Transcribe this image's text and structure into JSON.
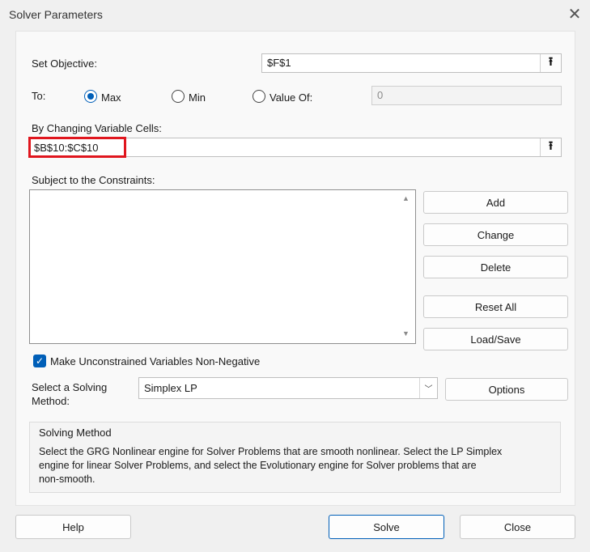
{
  "window": {
    "title": "Solver Parameters"
  },
  "objective": {
    "label": "Set Objective:",
    "value": "$F$1"
  },
  "to": {
    "label": "To:",
    "max_label": "Max",
    "min_label": "Min",
    "value_of_label": "Value Of:",
    "value_of_value": "0",
    "selected": "Max"
  },
  "changing": {
    "label": "By Changing Variable Cells:",
    "value": "$B$10:$C$10"
  },
  "constraints": {
    "label": "Subject to the Constraints:",
    "items": []
  },
  "buttons": {
    "add": "Add",
    "change": "Change",
    "delete": "Delete",
    "reset_all": "Reset All",
    "load_save": "Load/Save",
    "options": "Options",
    "help": "Help",
    "solve": "Solve",
    "close": "Close"
  },
  "nonneg": {
    "label": "Make Unconstrained Variables Non-Negative",
    "checked": true
  },
  "method": {
    "label_line1": "Select a Solving",
    "label_line2": "Method:",
    "selected": "Simplex LP"
  },
  "solving_method": {
    "heading": "Solving Method",
    "line1": "Select the GRG Nonlinear engine for Solver Problems that are smooth nonlinear. Select the LP Simplex",
    "line2": "engine for linear Solver Problems, and select the Evolutionary engine for Solver problems that are",
    "line3": "non-smooth."
  },
  "colors": {
    "accent": "#005fb8",
    "highlight": "#e0161e"
  }
}
